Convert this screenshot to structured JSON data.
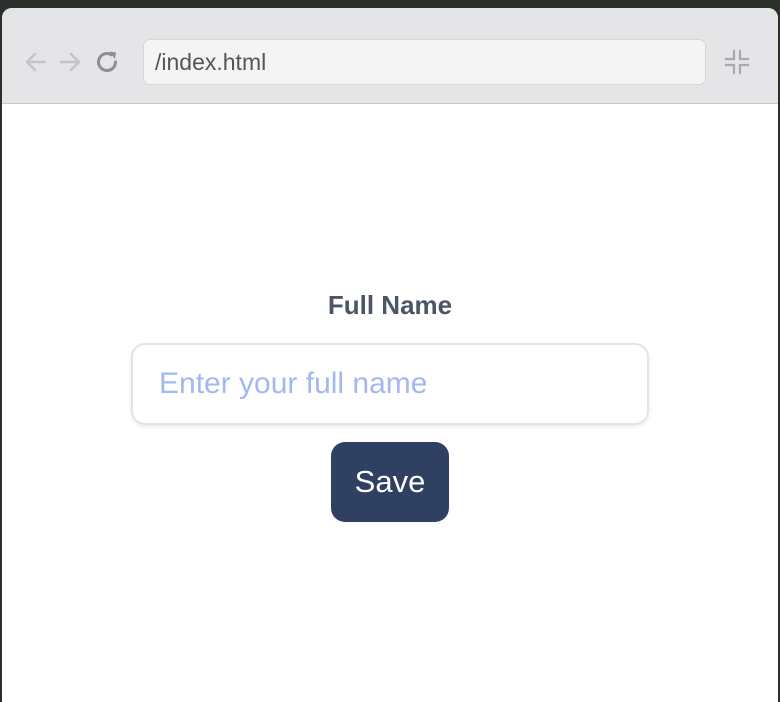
{
  "browser": {
    "address": "/index.html",
    "icons": {
      "back": "arrow-left-icon",
      "forward": "arrow-right-icon",
      "reload": "reload-icon",
      "fullscreen": "exit-fullscreen-icon"
    },
    "colors": {
      "toolbar": "#e5e5e7",
      "icon_disabled": "#c4c4c8",
      "icon_active": "#8e8e93"
    }
  },
  "form": {
    "label": "Full Name",
    "input_placeholder": "Enter your full name",
    "input_value": "",
    "save_label": "Save",
    "colors": {
      "label": "#4b5563",
      "placeholder": "#a3b8f0",
      "button_bg": "#2f4063",
      "button_text": "#ffffff"
    }
  }
}
